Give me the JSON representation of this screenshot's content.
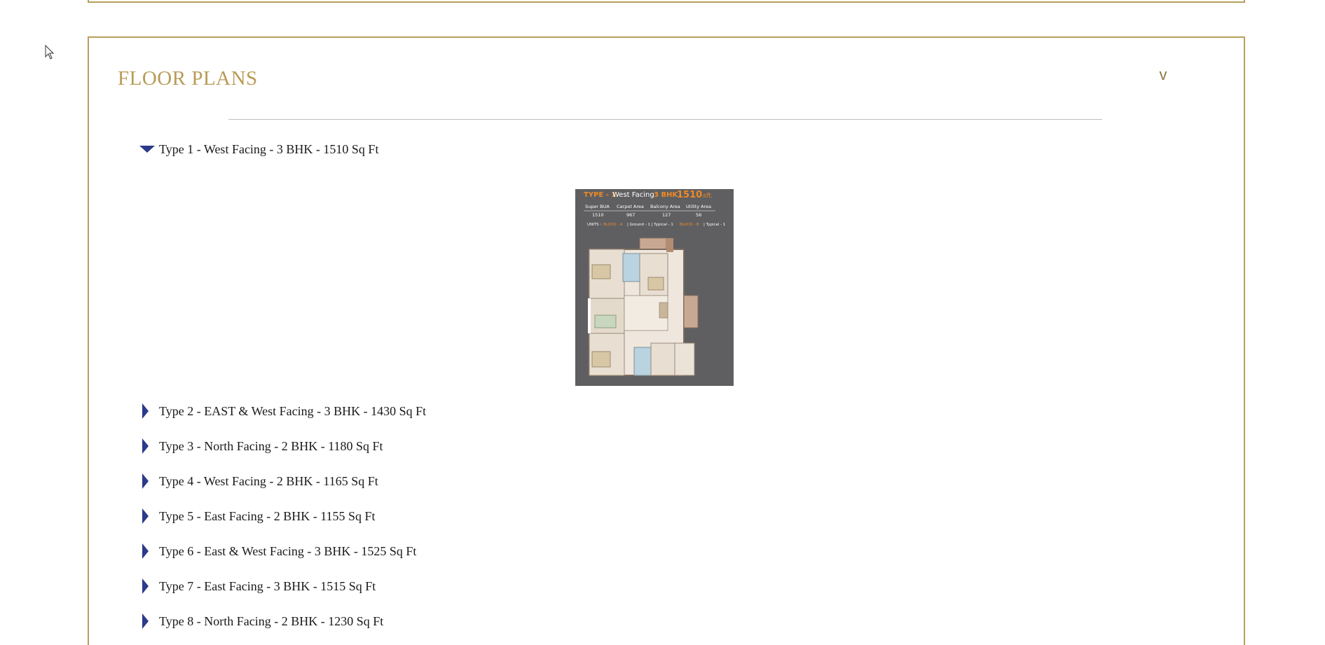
{
  "section": {
    "title": "FLOOR PLANS",
    "toggle_glyph": "v"
  },
  "plans": [
    {
      "label": "Type 1 -  West Facing -  3 BHK  - 1510 Sq Ft",
      "expanded": true
    },
    {
      "label": "Type 2 -  EAST & West Facing -  3 BHK  - 1430 Sq Ft",
      "expanded": false
    },
    {
      "label": "Type 3 -  North Facing -  2 BHK  - 1180 Sq Ft",
      "expanded": false
    },
    {
      "label": "Type 4 -  West Facing -  2 BHK  - 1165 Sq Ft",
      "expanded": false
    },
    {
      "label": "Type 5 -  East Facing -  2 BHK  - 1155 Sq Ft",
      "expanded": false
    },
    {
      "label": "Type 6 -  East & West Facing -  3 BHK  - 1525 Sq Ft",
      "expanded": false
    },
    {
      "label": "Type 7 -  East Facing -  3 BHK  - 1515 Sq Ft",
      "expanded": false
    },
    {
      "label": "Type 8 -  North Facing -  2 BHK  - 1230 Sq Ft",
      "expanded": false
    }
  ],
  "floor_plan_image": {
    "type_label": "TYPE - 1",
    "facing": "West Facing",
    "bhk": "3 BHK",
    "area": "1510",
    "area_unit": "sft.",
    "columns": [
      "Super BUA",
      "Carpet Area",
      "Balcony Area",
      "Utility Area"
    ],
    "values": [
      "1510",
      "967",
      "127",
      "56"
    ],
    "units_prefix": "UNITS :",
    "block_a": "BLOCK - A",
    "block_a_detail": "| Ground - 1 | Typical - 1",
    "block_b": "BLOCK - B",
    "block_b_detail": "| Typical - 1"
  },
  "colors": {
    "gold": "#b79f5b",
    "triangle": "#2b3a8a",
    "plan_bg": "#5f5f62",
    "orange": "#f08a24"
  }
}
